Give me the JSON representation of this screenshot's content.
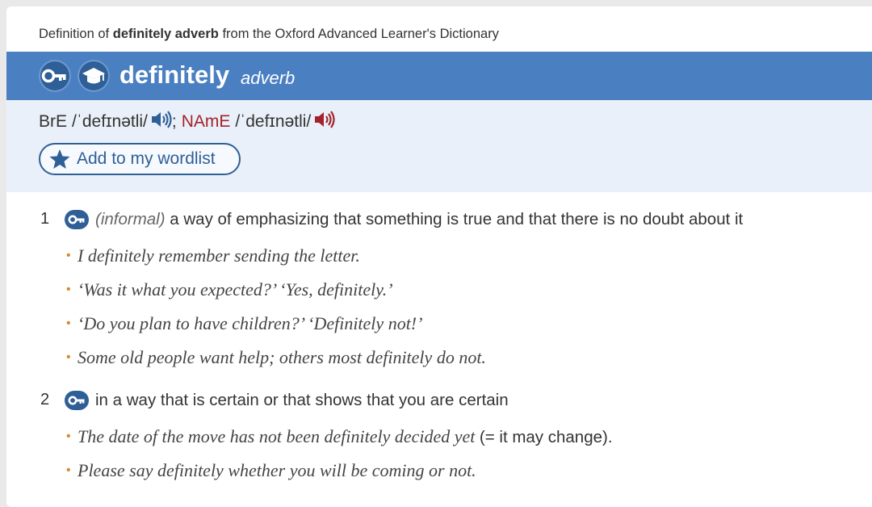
{
  "source": {
    "prefix": "Definition of",
    "word": "definitely adverb",
    "suffix": "from the Oxford Advanced Learner's Dictionary"
  },
  "entry": {
    "headword": "definitely",
    "pos": "adverb",
    "icons": [
      "key-icon",
      "academic-cap-icon"
    ]
  },
  "pron": {
    "bre_label": "BrE",
    "bre_ipa": "/ˈdefɪnətli/",
    "separator": ";",
    "name_label": "NAmE",
    "name_ipa": "/ˈdefɪnətli/"
  },
  "wordlist_button": {
    "label": "Add to my wordlist"
  },
  "senses": [
    {
      "num": "1",
      "register": "(informal)",
      "definition": "a way of emphasizing that something is true and that there is no doubt about it",
      "examples": [
        "I definitely remember sending the letter.",
        "‘Was it what you expected?’ ‘Yes, definitely.’",
        "‘Do you plan to have children?’ ‘Definitely not!’",
        "Some old people want help; others most definitely do not."
      ]
    },
    {
      "num": "2",
      "definition": "in a way that is certain or that shows that you are certain",
      "examples": [
        "The date of the move has not been definitely decided yet",
        "Please say definitely whether you will be coming or not."
      ],
      "example_gloss": "(= it may change)."
    }
  ],
  "colors": {
    "bar": "#4a7fc1",
    "icon_dark": "#2f5f97",
    "panel": "#eaf0f9",
    "name_red": "#a3232b",
    "bullet": "#d38b2a"
  }
}
